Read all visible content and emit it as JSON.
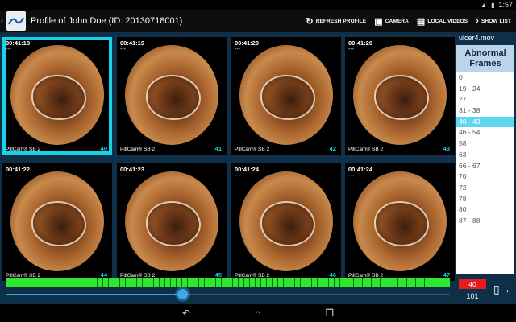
{
  "status": {
    "time": "1:57"
  },
  "header": {
    "title": "Profile of John Doe (ID: 20130718001)",
    "actions": [
      {
        "label": "REFRESH PROFILE",
        "icon": "refresh-icon"
      },
      {
        "label": "CAMERA",
        "icon": "camera-icon"
      },
      {
        "label": "LOCAL VIDEOS",
        "icon": "folder-icon"
      },
      {
        "label": "SHOW LIST",
        "icon": "chevron-right-icon"
      }
    ]
  },
  "frames": [
    {
      "time": "00:41:18",
      "sub": "---",
      "brand": "PillCam® SB 2",
      "num": "40",
      "selected": true
    },
    {
      "time": "00:41:19",
      "sub": "---",
      "brand": "PillCam® SB 2",
      "num": "41"
    },
    {
      "time": "00:41:20",
      "sub": "---",
      "brand": "PillCam® SB 2",
      "num": "42"
    },
    {
      "time": "00:41:20",
      "sub": "---",
      "brand": "PillCam® SB 2",
      "num": "43"
    },
    {
      "time": "00:41:22",
      "sub": "---",
      "brand": "PillCam® SB 2",
      "num": "44"
    },
    {
      "time": "00:41:23",
      "sub": "---",
      "brand": "PillCam® SB 2",
      "num": "45"
    },
    {
      "time": "00:41:24",
      "sub": "---",
      "brand": "PillCam® SB 2",
      "num": "46"
    },
    {
      "time": "00:41:24",
      "sub": "---",
      "brand": "PillCam® SB 2",
      "num": "47"
    }
  ],
  "side": {
    "file": "ulcer4.mov",
    "heading_line1": "Abnormal",
    "heading_line2": "Frames",
    "items": [
      "0",
      "19 - 24",
      "27",
      "31 - 38",
      "40 - 43",
      "46 - 54",
      "58",
      "63",
      "66 - 67",
      "70",
      "72",
      "78",
      "80",
      "87 - 88"
    ],
    "active_index": 4
  },
  "playback": {
    "current_frame": "40",
    "total_frames": "101",
    "position_fraction": 0.396
  },
  "colors": {
    "selection": "#18d2e6",
    "timeline": "#2ee82e",
    "frame_badge": "#e51d1d",
    "slider": "#39a9e8"
  }
}
